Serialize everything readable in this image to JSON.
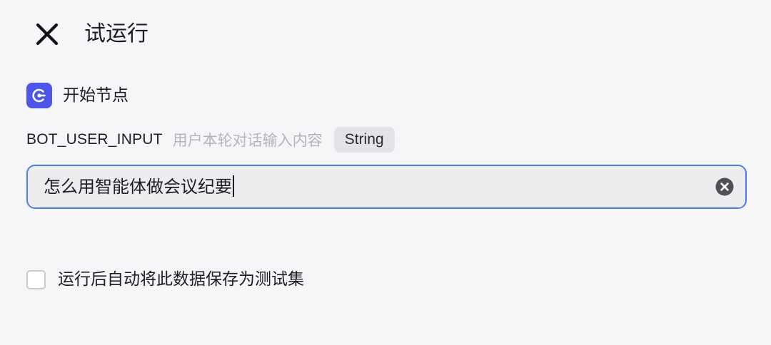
{
  "header": {
    "title": "试运行",
    "close_icon": "close-icon"
  },
  "node": {
    "icon": "start-node-icon",
    "icon_color": "#4e55ea",
    "label": "开始节点"
  },
  "param": {
    "name": "BOT_USER_INPUT",
    "description": "用户本轮对话输入内容",
    "type": "String"
  },
  "input": {
    "value": "怎么用智能体做会议纪要",
    "clear_icon": "clear-icon",
    "focus_color": "#4d7bf3"
  },
  "save_option": {
    "label": "运行后自动将此数据保存为测试集",
    "checked": false
  }
}
